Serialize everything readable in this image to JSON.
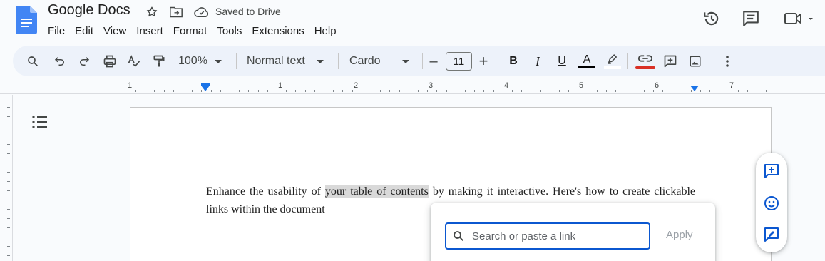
{
  "header": {
    "title": "Google Docs",
    "saved_status": "Saved to Drive",
    "menu": [
      "File",
      "Edit",
      "View",
      "Insert",
      "Format",
      "Tools",
      "Extensions",
      "Help"
    ]
  },
  "toolbar": {
    "zoom": "100%",
    "style": "Normal text",
    "font": "Cardo",
    "font_size": "11",
    "minus": "–",
    "plus": "+",
    "bold": "B",
    "italic": "I",
    "underline": "U",
    "text_color_letter": "A"
  },
  "ruler": {
    "numbers": [
      "1",
      "1",
      "2",
      "3",
      "4",
      "5",
      "6",
      "7"
    ]
  },
  "document": {
    "text_before": "Enhance the usability of ",
    "text_highlight": "your table of contents",
    "text_after": " by making it interactive. Here's how to create clickable links within the document"
  },
  "link_popup": {
    "placeholder": "Search or paste a link",
    "apply_label": "Apply"
  },
  "colors": {
    "accent": "#0b57d0",
    "toolbar_bg": "#edf2fa",
    "docs_blue": "#4285f4",
    "link_underline": "#d93025"
  }
}
